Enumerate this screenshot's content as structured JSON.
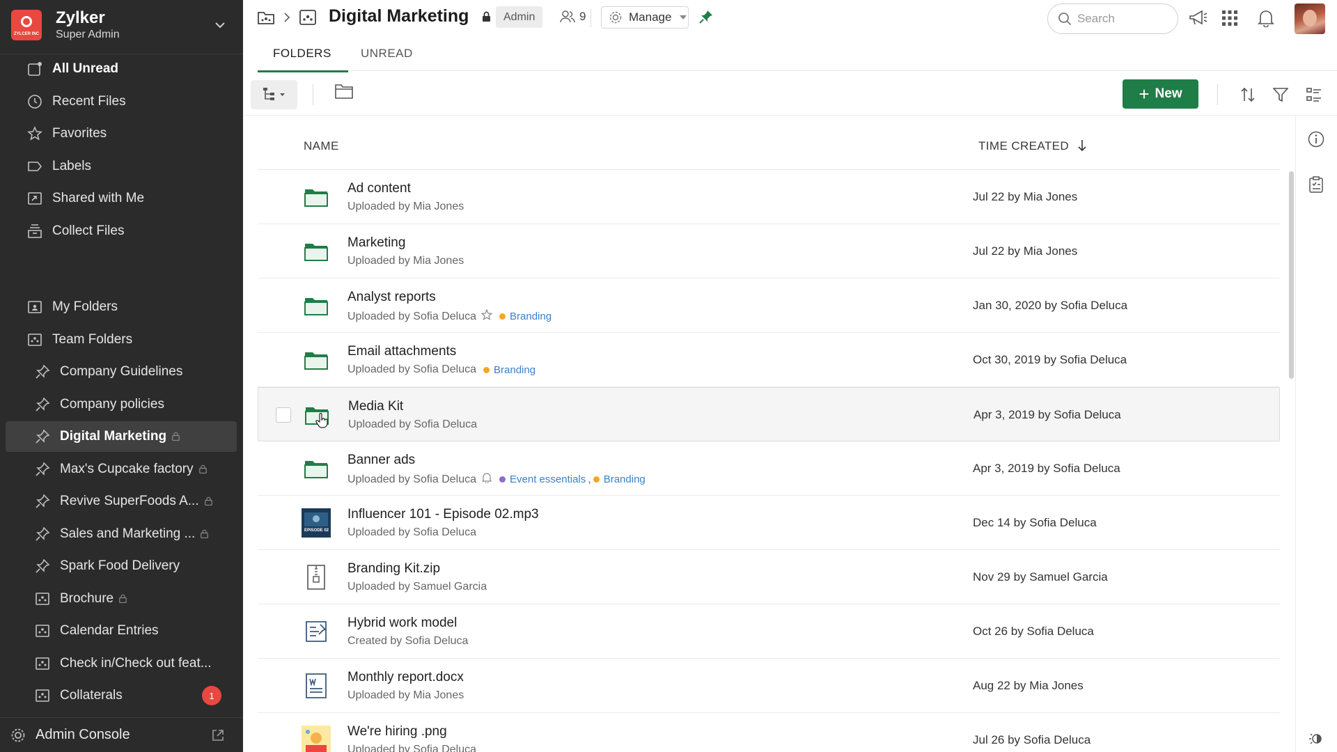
{
  "org": {
    "name": "Zylker",
    "role": "Super Admin",
    "logo_text": "ZYLCER INC"
  },
  "sidebar": {
    "top_items": [
      {
        "label": "All Unread",
        "icon": "inbox-unread-icon"
      },
      {
        "label": "Recent Files",
        "icon": "clock-icon"
      },
      {
        "label": "Favorites",
        "icon": "star-icon"
      },
      {
        "label": "Labels",
        "icon": "label-icon"
      },
      {
        "label": "Shared with Me",
        "icon": "shared-icon"
      },
      {
        "label": "Collect Files",
        "icon": "collect-icon"
      }
    ],
    "folder_items": [
      {
        "label": "My Folders",
        "icon": "my-folder-icon"
      },
      {
        "label": "Team Folders",
        "icon": "team-folder-icon"
      }
    ],
    "team_items": [
      {
        "label": "Company Guidelines",
        "icon": "pin-icon",
        "locked": false
      },
      {
        "label": "Company policies",
        "icon": "pin-icon",
        "locked": false
      },
      {
        "label": "Digital Marketing",
        "icon": "pin-icon",
        "locked": true,
        "active": true
      },
      {
        "label": "Max's Cupcake factory",
        "icon": "pin-icon",
        "locked": true
      },
      {
        "label": "Revive SuperFoods A...",
        "icon": "pin-icon",
        "locked": true
      },
      {
        "label": "Sales and Marketing ...",
        "icon": "pin-icon",
        "locked": true
      },
      {
        "label": "Spark Food Delivery",
        "icon": "pin-icon",
        "locked": false
      },
      {
        "label": "Brochure",
        "icon": "team-folder-icon",
        "locked": true
      },
      {
        "label": "Calendar Entries",
        "icon": "team-folder-icon",
        "locked": false
      },
      {
        "label": "Check in/Check out feat...",
        "icon": "team-folder-icon",
        "locked": false
      },
      {
        "label": "Collaterals",
        "icon": "team-folder-icon",
        "locked": false,
        "badge": "1"
      }
    ],
    "admin_console": "Admin Console"
  },
  "header": {
    "title": "Digital Marketing",
    "admin_tag": "Admin",
    "members_count": "9",
    "manage_label": "Manage",
    "search_placeholder": "Search"
  },
  "tabs": [
    {
      "label": "FOLDERS",
      "active": true
    },
    {
      "label": "UNREAD",
      "active": false
    }
  ],
  "toolbar": {
    "new_label": "New"
  },
  "table": {
    "col_name": "NAME",
    "col_time": "TIME CREATED",
    "rows": [
      {
        "name": "Ad content",
        "sub": "Uploaded by Mia Jones",
        "time": "Jul 22 by Mia Jones",
        "type": "folder"
      },
      {
        "name": "Marketing",
        "sub": "Uploaded by Mia Jones",
        "time": "Jul 22 by Mia Jones",
        "type": "folder"
      },
      {
        "name": "Analyst reports",
        "sub": "Uploaded by Sofia Deluca",
        "time": "Jan 30, 2020 by Sofia Deluca",
        "type": "folder",
        "sub_icon": "star-outline-icon",
        "tags": [
          {
            "label": "Branding",
            "color": "#f5a623"
          }
        ]
      },
      {
        "name": "Email attachments",
        "sub": "Uploaded by Sofia Deluca",
        "time": "Oct 30, 2019 by Sofia Deluca",
        "type": "folder",
        "tags": [
          {
            "label": "Branding",
            "color": "#f5a623"
          }
        ]
      },
      {
        "name": "Media Kit",
        "sub": "Uploaded by Sofia Deluca",
        "time": "Apr 3, 2019 by Sofia Deluca",
        "type": "folder",
        "hover": true
      },
      {
        "name": "Banner ads",
        "sub": "Uploaded by Sofia Deluca",
        "time": "Apr 3, 2019 by Sofia Deluca",
        "type": "folder",
        "sub_icon": "bell-outline-icon",
        "tags": [
          {
            "label": "Event essentials",
            "color": "#8e6bc8"
          },
          {
            "label": "Branding",
            "color": "#f5a623"
          }
        ]
      },
      {
        "name": "Influencer 101 - Episode 02.mp3",
        "sub": "Uploaded by Sofia Deluca",
        "time": "Dec 14 by Sofia Deluca",
        "type": "audio",
        "thumb_text": "EPISODE 02"
      },
      {
        "name": "Branding Kit.zip",
        "sub": "Uploaded by Samuel Garcia",
        "time": "Nov 29 by Samuel Garcia",
        "type": "zip"
      },
      {
        "name": "Hybrid work model",
        "sub": "Created by Sofia Deluca",
        "time": "Oct 26 by Sofia Deluca",
        "type": "doc-link"
      },
      {
        "name": "Monthly report.docx",
        "sub": "Uploaded by Mia Jones",
        "time": "Aug 22 by Mia Jones",
        "type": "docx"
      },
      {
        "name": "We're hiring .png",
        "sub": "Uploaded by Sofia Deluca",
        "time": "Jul 26 by Sofia Deluca",
        "type": "image"
      }
    ]
  },
  "colors": {
    "accent": "#1f7d47",
    "sidebar_bg": "#2b2b2b",
    "badge": "#e8483f",
    "tag_link": "#3a80c8"
  }
}
